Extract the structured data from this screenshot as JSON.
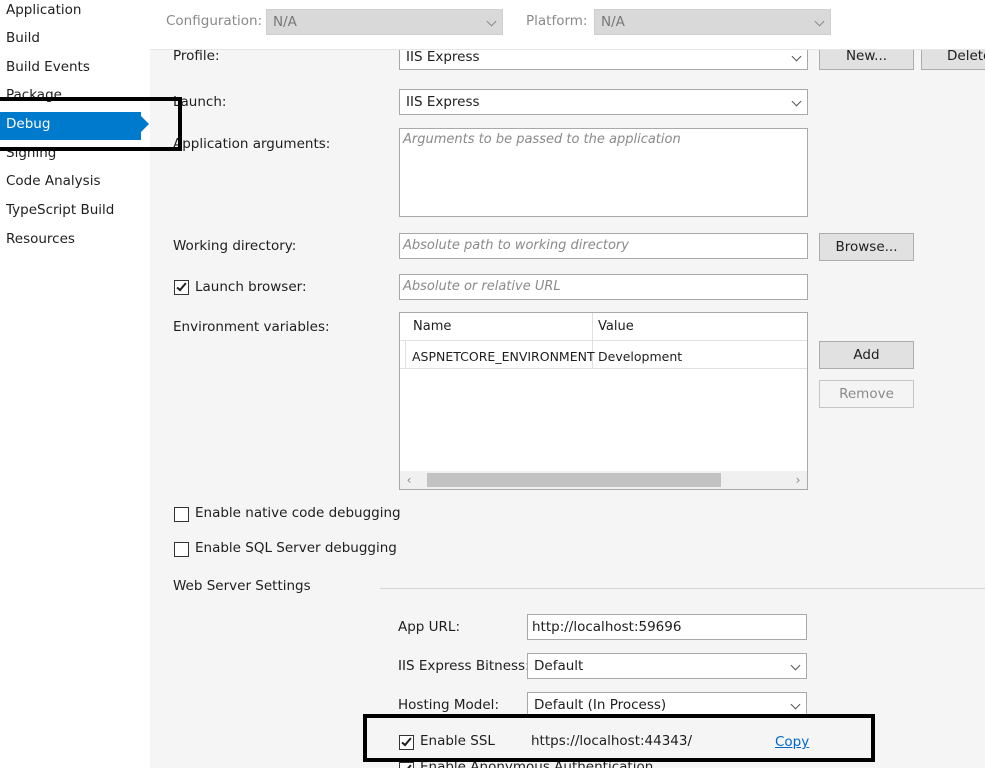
{
  "sidebar": {
    "items": [
      {
        "label": "Application"
      },
      {
        "label": "Build"
      },
      {
        "label": "Build Events"
      },
      {
        "label": "Package"
      },
      {
        "label": "Debug"
      },
      {
        "label": "Signing"
      },
      {
        "label": "Code Analysis"
      },
      {
        "label": "TypeScript Build"
      },
      {
        "label": "Resources"
      }
    ],
    "active": "Debug"
  },
  "topbar": {
    "configuration_label": "Configuration:",
    "configuration_value": "N/A",
    "platform_label": "Platform:",
    "platform_value": "N/A"
  },
  "profile": {
    "label": "Profile:",
    "value": "IIS Express",
    "new_button": "New...",
    "delete_button": "Delete"
  },
  "launch": {
    "label": "Launch:",
    "value": "IIS Express"
  },
  "app_args": {
    "label": "Application arguments:",
    "placeholder": "Arguments to be passed to the application"
  },
  "working_dir": {
    "label": "Working directory:",
    "placeholder": "Absolute path to working directory",
    "browse_button": "Browse..."
  },
  "launch_browser": {
    "label": "Launch browser:",
    "checked": true,
    "placeholder": "Absolute or relative URL"
  },
  "env_vars": {
    "label": "Environment variables:",
    "columns": [
      "Name",
      "Value"
    ],
    "rows": [
      {
        "name": "ASPNETCORE_ENVIRONMENT",
        "value": "Development"
      }
    ],
    "add_button": "Add",
    "remove_button": "Remove"
  },
  "native_debugging": {
    "label": "Enable native code debugging",
    "checked": false
  },
  "sql_debugging": {
    "label": "Enable SQL Server debugging",
    "checked": false
  },
  "web_server": {
    "section_label": "Web Server Settings",
    "app_url_label": "App URL:",
    "app_url_value": "http://localhost:59696",
    "bitness_label": "IIS Express Bitness:",
    "bitness_value": "Default",
    "hosting_label": "Hosting Model:",
    "hosting_value": "Default (In Process)",
    "ssl_label": "Enable SSL",
    "ssl_checked": true,
    "ssl_url": "https://localhost:44343/",
    "copy_link": "Copy",
    "anon_auth_label": "Enable Anonymous Authentication"
  },
  "colors": {
    "accent": "#007acc",
    "link": "#0066cc",
    "highlight": "#000000"
  }
}
